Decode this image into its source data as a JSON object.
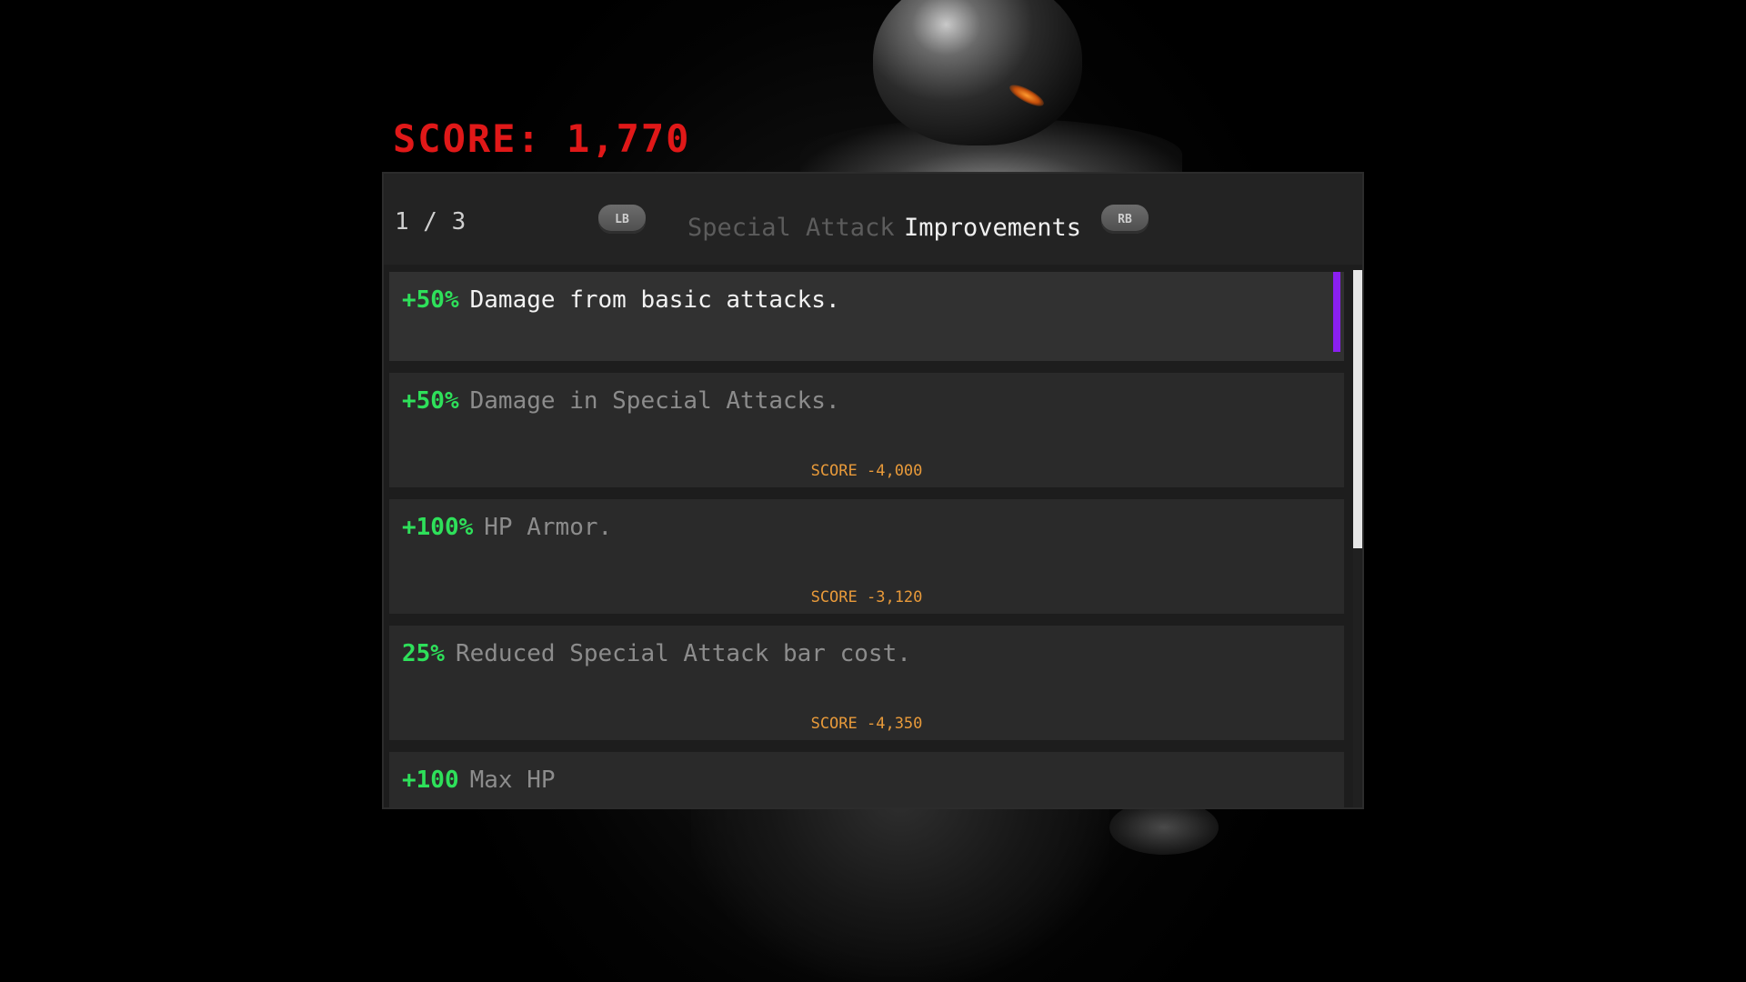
{
  "score": {
    "label": "SCORE: 1,770"
  },
  "header": {
    "page_indicator": "1 / 3",
    "lb_label": "LB",
    "rb_label": "RB",
    "tabs": [
      {
        "label": "Special Attack",
        "active": false
      },
      {
        "label": "Improvements",
        "active": true
      }
    ]
  },
  "upgrades": [
    {
      "bonus": "+50%",
      "description": "Damage from basic attacks.",
      "cost": ""
    },
    {
      "bonus": "+50%",
      "description": "Damage in Special Attacks.",
      "cost": "SCORE -4,000"
    },
    {
      "bonus": "+100%",
      "description": "HP Armor.",
      "cost": "SCORE -3,120"
    },
    {
      "bonus": "25%",
      "description": "Reduced Special Attack bar cost.",
      "cost": "SCORE -4,350"
    },
    {
      "bonus": "+100",
      "description": "Max HP",
      "cost": ""
    }
  ],
  "colors": {
    "score": "#e01818",
    "bonus": "#2ee05a",
    "cost": "#e89a3a",
    "selection": "#8a1ff0"
  }
}
